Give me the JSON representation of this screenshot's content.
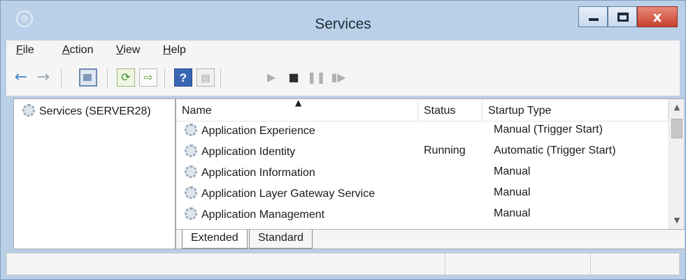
{
  "window": {
    "title": "Services"
  },
  "menu": {
    "items": [
      "File",
      "Action",
      "View",
      "Help"
    ]
  },
  "tree": {
    "root_label": "Services (SERVER28)"
  },
  "list": {
    "columns": [
      "Name",
      "Status",
      "Startup Type"
    ],
    "rows": [
      {
        "name": "Application Experience",
        "status": "",
        "startup": "Manual (Trigger Start)"
      },
      {
        "name": "Application Identity",
        "status": "Running",
        "startup": "Automatic (Trigger Start)"
      },
      {
        "name": "Application Information",
        "status": "",
        "startup": "Manual"
      },
      {
        "name": "Application Layer Gateway Service",
        "status": "",
        "startup": "Manual"
      },
      {
        "name": "Application Management",
        "status": "",
        "startup": "Manual"
      }
    ]
  },
  "tabs": [
    "Extended",
    "Standard"
  ],
  "icons": {
    "back": "←",
    "forward": "→",
    "refresh": "⟳",
    "export": "⇨",
    "help": "?",
    "properties": "▤",
    "start": "▶",
    "stop": "■",
    "pause": "❚❚",
    "restart": "▮▶",
    "minimize": "—",
    "maximize": "□",
    "close": "x"
  },
  "colors": {
    "titlebar": "#b9d0e8",
    "close_button": "#c8402e"
  }
}
